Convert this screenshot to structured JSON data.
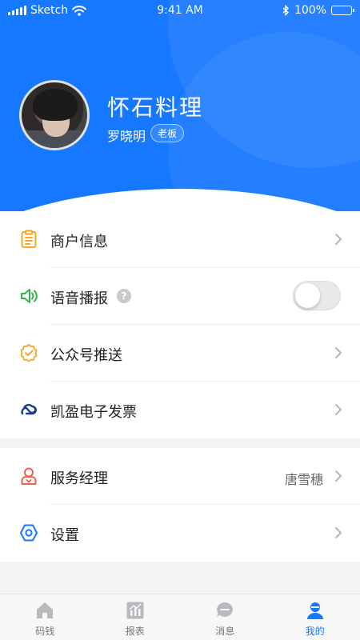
{
  "status_bar": {
    "carrier": "Sketch",
    "time": "9:41 AM",
    "battery": "100%"
  },
  "profile": {
    "shop_name": "怀石料理",
    "owner_name": "罗晓明",
    "role": "老板"
  },
  "menu_group1": [
    {
      "label": "商户信息",
      "icon": "clipboard-icon"
    },
    {
      "label": "语音播报",
      "icon": "speaker-icon",
      "toggle_on": false
    },
    {
      "label": "公众号推送",
      "icon": "verified-badge-icon"
    },
    {
      "label": "凯盈电子发票",
      "icon": "cloud-link-icon"
    }
  ],
  "menu_group2": [
    {
      "label": "服务经理",
      "icon": "person-icon",
      "value": "唐雪穗"
    },
    {
      "label": "设置",
      "icon": "settings-hex-icon"
    }
  ],
  "help_mark": "?",
  "tabs": [
    {
      "label": "码钱",
      "icon": "home-icon"
    },
    {
      "label": "报表",
      "icon": "chart-icon"
    },
    {
      "label": "消息",
      "icon": "message-icon"
    },
    {
      "label": "我的",
      "icon": "mine-icon",
      "active": true
    }
  ],
  "colors": {
    "primary": "#1677ff",
    "icon_orange": "#f5a623",
    "icon_green": "#2db34a",
    "icon_navy": "#1a3a8f",
    "icon_red": "#f0604a",
    "icon_blue": "#1677ff"
  }
}
